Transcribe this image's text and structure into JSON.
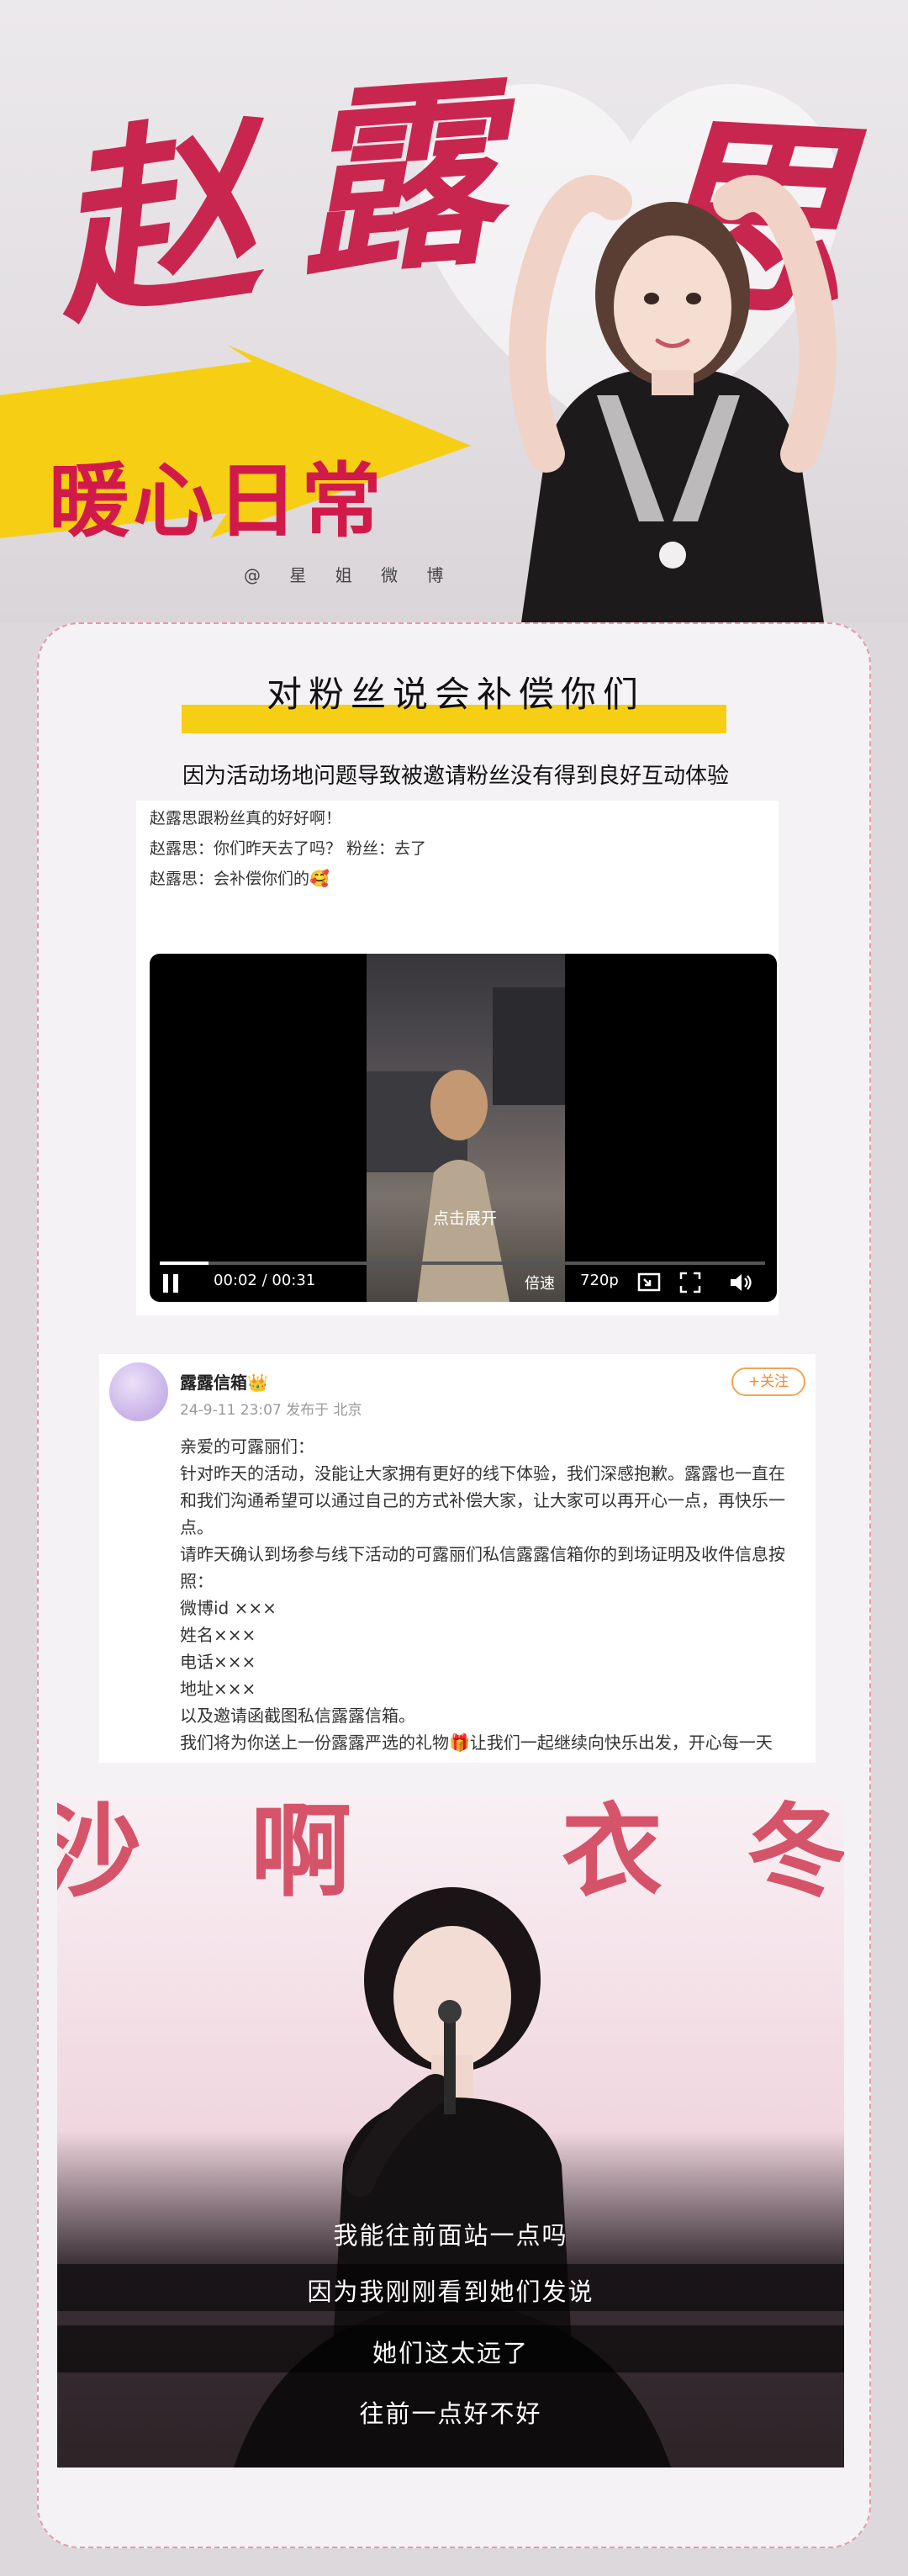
{
  "hero": {
    "title_chars": [
      "赵",
      "露",
      "思"
    ],
    "subtitle": "暖心日常",
    "handle": "@ 星 姐 微 博"
  },
  "section": {
    "title": "对粉丝说会补偿你们",
    "subhead": "因为活动场地问题导致被邀请粉丝没有得到良好互动体验"
  },
  "post": {
    "lines": [
      "赵露思跟粉丝真的好好啊！",
      "赵露思：你们昨天去了吗？ 粉丝：去了",
      "赵露思：会补偿你们的🥰"
    ],
    "video": {
      "expand_label": "点击展开",
      "time": "00:02 / 00:31",
      "speed_label": "倍速",
      "quality_label": "720p",
      "progress": 0.08
    }
  },
  "post2": {
    "account": "露露信箱👑",
    "meta": "24-9-11 23:07  发布于 北京",
    "follow_label": "+关注",
    "lines": [
      "亲爱的可露丽们：",
      "针对昨天的活动，没能让大家拥有更好的线下体验，我们深感抱歉。露露也一直在",
      "和我们沟通希望可以通过自己的方式补偿大家，让大家可以再开心一点，再快乐一",
      "点。",
      "请昨天确认到场参与线下活动的可露丽们私信露露信箱你的到场证明及收件信息按",
      "照：",
      "微博id ×××",
      "姓名×××",
      "电话×××",
      "地址×××",
      "以及邀请函截图私信露露信箱。",
      "我们将为你送上一份露露严选的礼物🎁让我们一起继续向快乐出发，开心每一天"
    ]
  },
  "photo3": {
    "captions": [
      "我能往前面站一点吗",
      "因为我刚刚看到她们发说",
      "她们这太远了",
      "往前一点好不好"
    ]
  },
  "colors": {
    "accent_red": "#c9264f",
    "yellow": "#f6cf14",
    "card_border": "#e79aa8"
  }
}
